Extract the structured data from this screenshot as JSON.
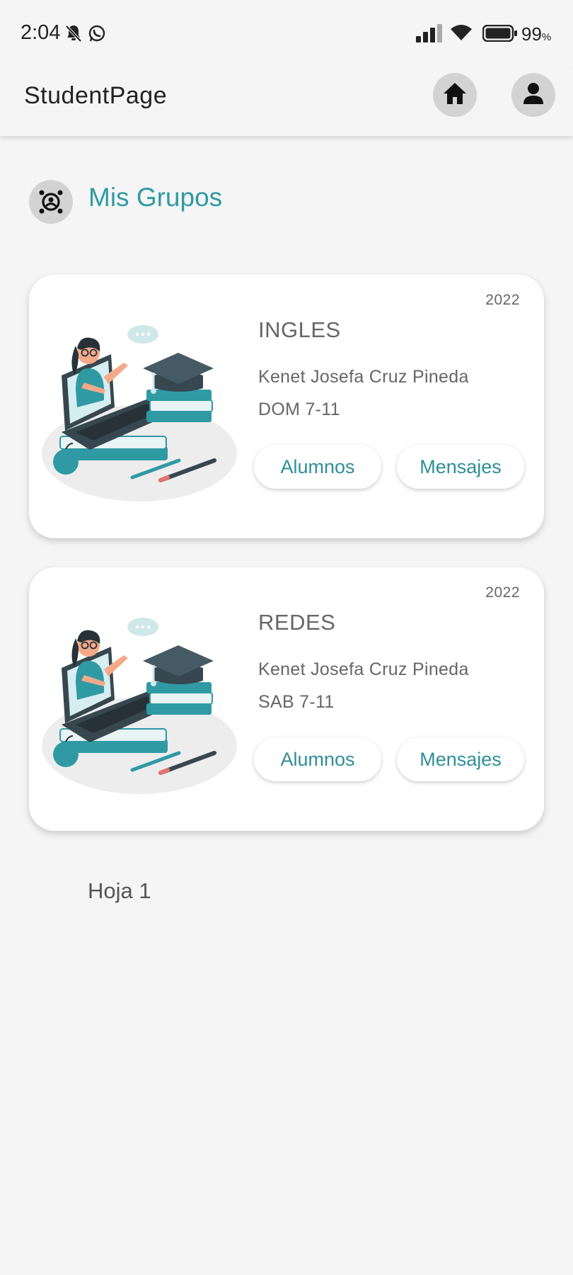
{
  "status_bar": {
    "time": "2:04",
    "battery_percent": "99",
    "battery_unit": "%",
    "icons": [
      "bell-off-icon",
      "whatsapp-icon",
      "signal-icon",
      "wifi-icon",
      "battery-icon"
    ]
  },
  "app_bar": {
    "title": "StudentPage",
    "home_icon": "home-icon",
    "profile_icon": "person-icon"
  },
  "section": {
    "title": "Mis Grupos",
    "icon": "groups-icon"
  },
  "groups": [
    {
      "year": "2022",
      "subject": "INGLES",
      "teacher": "Kenet Josefa Cruz Pineda",
      "schedule": "DOM 7-11",
      "students_label": "Alumnos",
      "messages_label": "Mensajes"
    },
    {
      "year": "2022",
      "subject": "REDES",
      "teacher": "Kenet Josefa Cruz Pineda",
      "schedule": "SAB 7-11",
      "students_label": "Alumnos",
      "messages_label": "Mensajes"
    }
  ],
  "page_label": "Hoja 1",
  "colors": {
    "accent": "#2f9aa3",
    "background": "#f5f5f5",
    "icon_button_bg": "#d3d3d3"
  }
}
